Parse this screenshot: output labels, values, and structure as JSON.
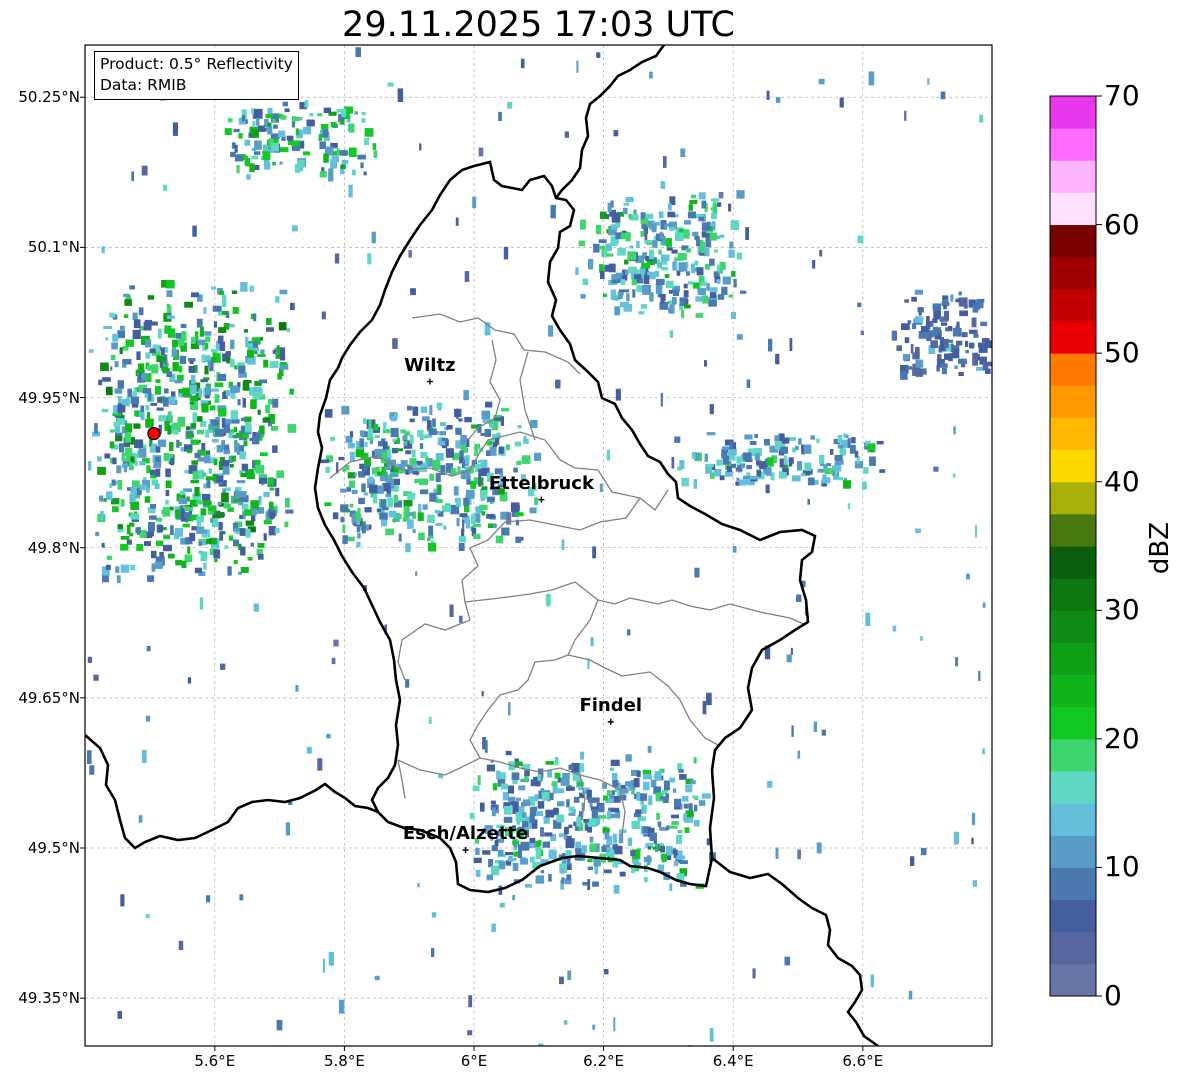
{
  "title": "29.11.2025 17:03 UTC",
  "info_box": {
    "product": "Product: 0.5° Reflectivity",
    "data": "Data: RMIB"
  },
  "map": {
    "lon_range": [
      5.4,
      6.8
    ],
    "lat_range": [
      49.3,
      50.3
    ],
    "lat_ticks": [
      {
        "value": 50.25,
        "label": "50.25°N"
      },
      {
        "value": 50.1,
        "label": "50.1°N"
      },
      {
        "value": 49.95,
        "label": "49.95°N"
      },
      {
        "value": 49.8,
        "label": "49.8°N"
      },
      {
        "value": 49.65,
        "label": "49.65°N"
      },
      {
        "value": 49.5,
        "label": "49.5°N"
      },
      {
        "value": 49.35,
        "label": "49.35°N"
      }
    ],
    "lon_ticks": [
      {
        "value": 5.6,
        "label": "5.6°E"
      },
      {
        "value": 5.8,
        "label": "5.8°E"
      },
      {
        "value": 6.0,
        "label": "6°E"
      },
      {
        "value": 6.2,
        "label": "6.2°E"
      },
      {
        "value": 6.4,
        "label": "6.4°E"
      },
      {
        "value": 6.6,
        "label": "6.6°E"
      }
    ],
    "grid": true,
    "radar_site": {
      "lon": 5.506,
      "lat": 49.914,
      "color": "#ff0000"
    },
    "cities": [
      {
        "name": "Wiltz",
        "lon": 5.932,
        "lat": 49.966
      },
      {
        "name": "Ettelbruck",
        "lon": 6.104,
        "lat": 49.848
      },
      {
        "name": "Findel",
        "lon": 6.211,
        "lat": 49.626
      },
      {
        "name": "Esch/Alzette",
        "lon": 5.987,
        "lat": 49.498
      }
    ]
  },
  "colorbar": {
    "label": "dBZ",
    "min": 0,
    "max": 70,
    "ticks": [
      0,
      10,
      20,
      30,
      40,
      50,
      60,
      70
    ],
    "colors": [
      "#6676a8",
      "#55679e",
      "#455ea0",
      "#4a79b0",
      "#5a9cc8",
      "#64bfdc",
      "#5ed8c4",
      "#3ed46e",
      "#12c824",
      "#10b51c",
      "#10a018",
      "#108a14",
      "#0e7610",
      "#0a5e0c",
      "#4a7810",
      "#aab00a",
      "#ffd800",
      "#ffba00",
      "#ff9a00",
      "#ff7a00",
      "#e80000",
      "#c00000",
      "#9e0000",
      "#780000",
      "#ffe0ff",
      "#ffb4ff",
      "#ff6cff",
      "#e838ee"
    ]
  },
  "chart_data": {
    "type": "heatmap",
    "title": "29.11.2025 17:03 UTC",
    "value_label": "dBZ",
    "value_range": [
      0,
      70
    ],
    "echo_regions": [
      {
        "lon": [
          5.4,
          5.72
        ],
        "lat": [
          49.76,
          50.07
        ],
        "typical_dbz": [
          5,
          25
        ]
      },
      {
        "lon": [
          5.75,
          6.1
        ],
        "lat": [
          49.8,
          49.95
        ],
        "typical_dbz": [
          5,
          20
        ]
      },
      {
        "lon": [
          6.15,
          6.42
        ],
        "lat": [
          50.03,
          50.16
        ],
        "typical_dbz": [
          5,
          20
        ]
      },
      {
        "lon": [
          6.3,
          6.65
        ],
        "lat": [
          49.86,
          49.92
        ],
        "typical_dbz": [
          5,
          18
        ]
      },
      {
        "lon": [
          6.64,
          6.81
        ],
        "lat": [
          49.97,
          50.06
        ],
        "typical_dbz": [
          3,
          10
        ]
      },
      {
        "lon": [
          5.98,
          6.37
        ],
        "lat": [
          49.46,
          49.6
        ],
        "typical_dbz": [
          5,
          18
        ]
      },
      {
        "lon": [
          5.6,
          5.85
        ],
        "lat": [
          50.17,
          50.25
        ],
        "typical_dbz": [
          5,
          22
        ]
      }
    ]
  }
}
